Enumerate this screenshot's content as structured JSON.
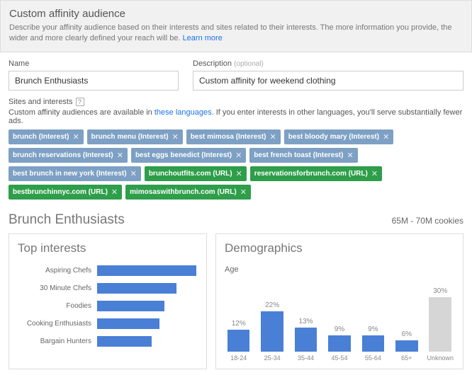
{
  "header": {
    "title": "Custom affinity audience",
    "description_prefix": "Describe your affinity audience based on their interests and sites related to their interests. The more information you provide, the wider and more clearly defined your reach will be. ",
    "learn_more": "Learn more"
  },
  "form": {
    "name_label": "Name",
    "name_value": "Brunch Enthusiasts",
    "desc_label": "Description",
    "desc_optional": "(optional)",
    "desc_value": "Custom affinity for weekend clothing"
  },
  "sites": {
    "label": "Sites and interests",
    "note_prefix": "Custom affinity audiences are available in ",
    "note_link": "these languages",
    "note_suffix": ". If you enter interests in other languages, you'll serve substantially fewer ads.",
    "chips": [
      {
        "text": "brunch (Interest)",
        "type": "interest"
      },
      {
        "text": "brunch menu (Interest)",
        "type": "interest"
      },
      {
        "text": "best mimosa (Interest)",
        "type": "interest"
      },
      {
        "text": "best bloody mary (Interest)",
        "type": "interest"
      },
      {
        "text": "brunch reservations (Interest)",
        "type": "interest"
      },
      {
        "text": "best eggs benedict (Interest)",
        "type": "interest"
      },
      {
        "text": "best french toast (Interest)",
        "type": "interest"
      },
      {
        "text": "best brunch in new york (Interest)",
        "type": "interest"
      },
      {
        "text": "brunchoutfits.com (URL)",
        "type": "url"
      },
      {
        "text": "reservationsforbrunch.com (URL)",
        "type": "url"
      },
      {
        "text": "bestbrunchinnyc.com (URL)",
        "type": "url"
      },
      {
        "text": "mimosaswithbrunch.com (URL)",
        "type": "url"
      }
    ]
  },
  "insights": {
    "audience_name": "Brunch Enthusiasts",
    "cookies": "65M - 70M cookies",
    "top_interests_title": "Top interests",
    "demographics_title": "Demographics",
    "demographics_sub": "Age"
  },
  "chart_data": [
    {
      "type": "bar",
      "title": "Top interests",
      "orientation": "horizontal",
      "categories": [
        "Aspiring Chefs",
        "30 Minute Chefs",
        "Foodies",
        "Cooking Enthusiasts",
        "Bargain Hunters"
      ],
      "values": [
        100,
        80,
        68,
        63,
        55
      ],
      "xlim": [
        0,
        100
      ],
      "note": "values are relative bar widths (index, max=100)"
    },
    {
      "type": "bar",
      "title": "Demographics — Age",
      "categories": [
        "18-24",
        "25-34",
        "35-44",
        "45-54",
        "55-64",
        "65+",
        "Unknown"
      ],
      "values": [
        12,
        22,
        13,
        9,
        9,
        6,
        30
      ],
      "ylabel": "%",
      "ylim": [
        0,
        35
      ]
    }
  ]
}
